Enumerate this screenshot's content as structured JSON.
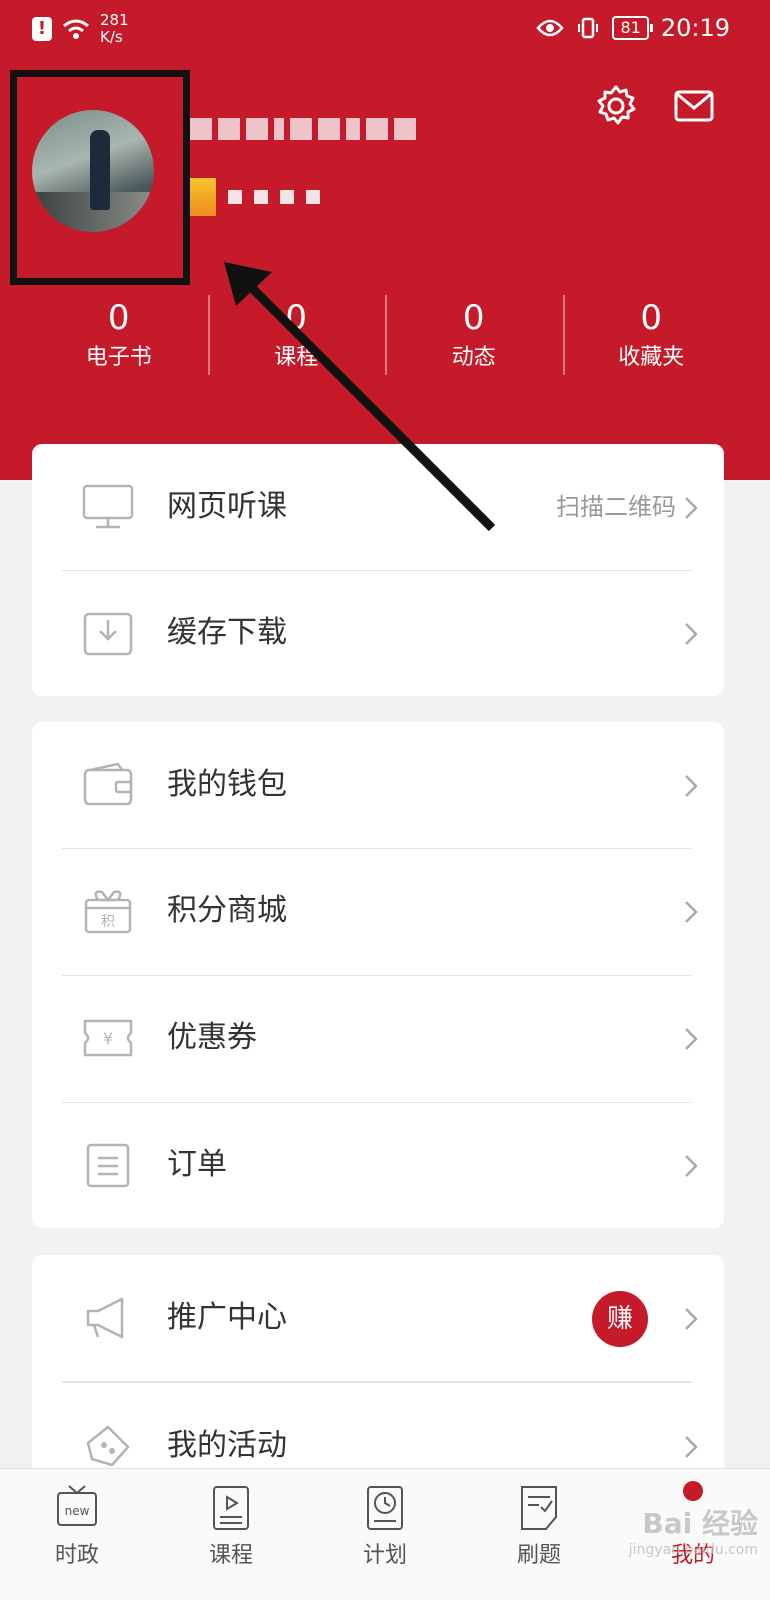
{
  "status_bar": {
    "speed_value": "281",
    "speed_unit": "K/s",
    "battery": "81",
    "time": "20:19"
  },
  "stats": [
    {
      "value": "0",
      "label": "电子书"
    },
    {
      "value": "0",
      "label": "课程"
    },
    {
      "value": "0",
      "label": "动态"
    },
    {
      "value": "0",
      "label": "收藏夹"
    }
  ],
  "menu": {
    "group1": [
      {
        "label": "网页听课",
        "extra": "扫描二维码",
        "icon": "monitor-icon"
      },
      {
        "label": "缓存下载",
        "icon": "download-icon"
      }
    ],
    "group2": [
      {
        "label": "我的钱包",
        "icon": "wallet-icon"
      },
      {
        "label": "积分商城",
        "icon": "gift-icon",
        "icon_text": "积"
      },
      {
        "label": "优惠券",
        "icon": "coupon-icon",
        "icon_text": "¥"
      },
      {
        "label": "订单",
        "icon": "order-icon"
      }
    ],
    "group3": [
      {
        "label": "推广中心",
        "badge": "赚",
        "icon": "megaphone-icon"
      },
      {
        "label": "我的活动",
        "icon": "activity-icon"
      }
    ]
  },
  "nav": [
    {
      "label": "时政",
      "icon": "tv-new-icon",
      "icon_text": "new"
    },
    {
      "label": "课程",
      "icon": "course-icon"
    },
    {
      "label": "计划",
      "icon": "clock-icon"
    },
    {
      "label": "刷题",
      "icon": "exercise-icon"
    },
    {
      "label": "我的",
      "icon": "me-icon",
      "active": true
    }
  ],
  "watermark": {
    "main": "Bai 经验",
    "sub": "jingyan.baidu.com"
  },
  "colors": {
    "brand_red": "#c41a2a",
    "icon_gray": "#b3b3b3"
  }
}
